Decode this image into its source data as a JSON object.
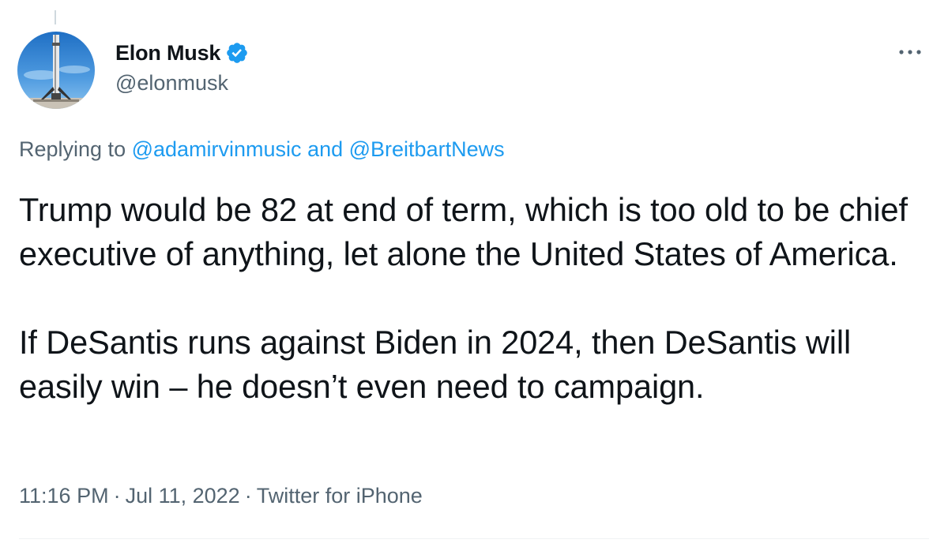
{
  "author": {
    "display_name": "Elon Musk",
    "handle": "@elonmusk",
    "avatar_icon": "rocket-booster-photo",
    "verified_icon": "verified-badge-icon",
    "verified_color": "#1d9bf0"
  },
  "menu": {
    "more_icon": "more-horizontal-icon"
  },
  "reply": {
    "prefix": "Replying to ",
    "mention_1": "@adamirvinmusic",
    "joiner": " and ",
    "mention_2": "@BreitbartNews"
  },
  "tweet": {
    "paragraph_1": "Trump would be 82 at end of term, which is too old to be chief executive of anything, let alone the United States of America.",
    "paragraph_2": "If DeSantis runs against Biden in 2024, then DeSantis will easily win – he doesn’t even need to campaign."
  },
  "meta": {
    "time": "11:16 PM",
    "separator": "·",
    "date": "Jul 11, 2022",
    "source": "Twitter for iPhone"
  },
  "colors": {
    "text": "#0f1419",
    "secondary": "#536471",
    "link": "#1d9bf0"
  }
}
